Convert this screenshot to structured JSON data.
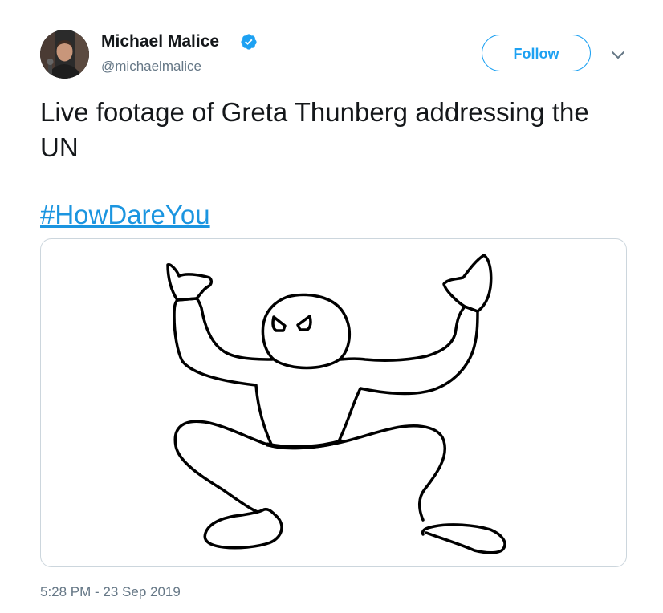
{
  "author": {
    "name": "Michael Malice",
    "handle": "@michaelmalice",
    "verified": true
  },
  "icons": {
    "verified": "verified-badge-icon",
    "caret": "chevron-down-icon"
  },
  "follow_label": "Follow",
  "text": "Live footage of Greta Thunberg addressing the UN",
  "hashtag": "#HowDareYou",
  "timestamp": "5:28 PM - 23 Sep 2019",
  "colors": {
    "accent": "#1da1f2",
    "link": "#1b95e0",
    "secondary_text": "#657786",
    "border": "#ccd6dd"
  }
}
